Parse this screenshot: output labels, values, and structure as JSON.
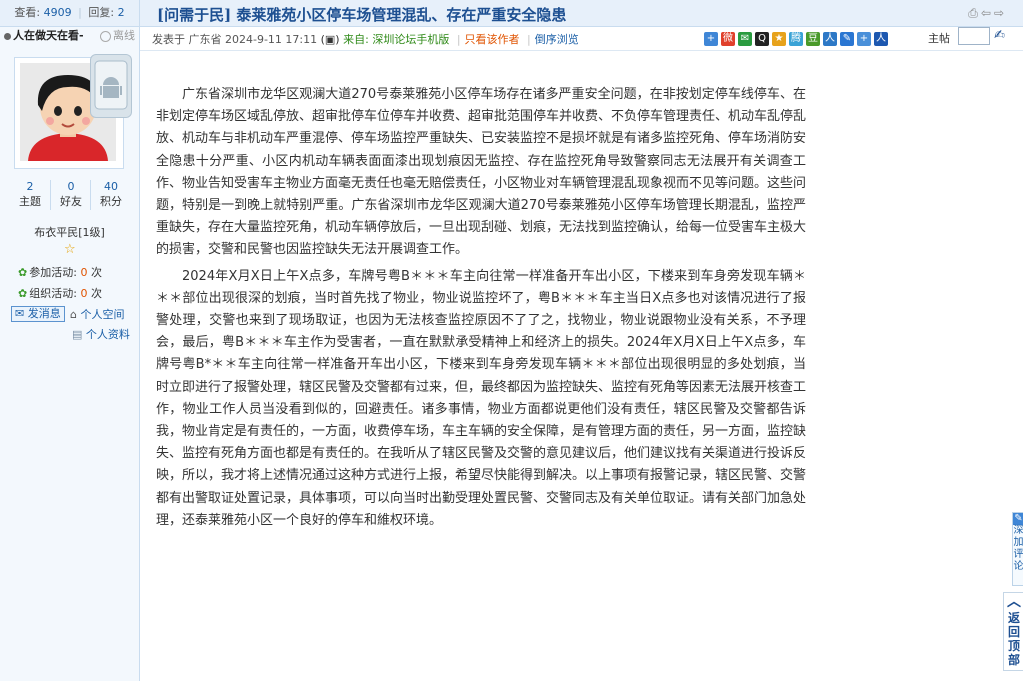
{
  "stats": {
    "views_label": "查看:",
    "views": "4909",
    "replies_label": "回复:",
    "replies": "2"
  },
  "user": {
    "name": "人在做天在看-",
    "status": "离线",
    "counts": [
      {
        "value": "2",
        "label": "主题"
      },
      {
        "value": "0",
        "label": "好友"
      },
      {
        "value": "40",
        "label": "积分"
      }
    ],
    "rank": "布衣平民[1级]",
    "activity1_label": "参加活动:",
    "activity1_value": "0",
    "activity1_unit": "次",
    "activity2_label": "组织活动:",
    "activity2_value": "0",
    "activity2_unit": "次",
    "send_msg": "发消息",
    "space_link": "个人空间",
    "profile_link": "个人资料"
  },
  "thread": {
    "title": "[问需于民] 泰莱雅苑小区停车场管理混乱、存在严重安全隐患",
    "posted_prefix": "发表于 广东省 2024-9-11 17:11",
    "source_label": "来自:",
    "source": "深圳论坛手机版",
    "only_author": "只看该作者",
    "reverse": "倒序浏览",
    "floor_label": "主帖"
  },
  "post": {
    "paragraphs": [
      "广东省深圳市龙华区观澜大道270号泰莱雅苑小区停车场存在诸多严重安全问题，在非按划定停车线停车、在非划定停车场区域乱停放、超审批停车位停车并收费、超审批范围停车并收费、不负停车管理责任、机动车乱停乱放、机动车与非机动车严重混停、停车场监控严重缺失、已安装监控不是损坏就是有诸多监控死角、停车场消防安全隐患十分严重、小区内机动车辆表面面漆出现划痕因无监控、存在监控死角导致警察同志无法展开有关调查工作、物业告知受害车主物业方面毫无责任也毫无赔偿责任，小区物业对车辆管理混乱现象视而不见等问题。这些问题，特别是一到晚上就特别严重。广东省深圳市龙华区观澜大道270号泰莱雅苑小区停车场管理长期混乱，监控严重缺失，存在大量监控死角，机动车辆停放后，一旦出现刮碰、划痕，无法找到监控确认，给每一位受害车主极大的损害，交警和民警也因监控缺失无法开展调查工作。",
      "2024年X月X日上午X点多，车牌号粤B＊＊＊车主向往常一样准备开车出小区，下楼来到车身旁发现车辆＊＊＊部位出现很深的划痕，当时首先找了物业，物业说监控坏了，粤B＊＊＊车主当日X点多也对该情况进行了报警处理，交警也来到了现场取证，也因为无法核查监控原因不了了之，找物业，物业说跟物业没有关系，不予理会，最后，粤B＊＊＊车主作为受害者，一直在默默承受精神上和经济上的损失。2024年X月X日上午X点多，车牌号粤B*＊＊车主向往常一样准备开车出小区，下楼来到车身旁发现车辆＊＊＊部位出现很明显的多处划痕，当时立即进行了报警处理，辖区民警及交警都有过来，但，最终都因为监控缺失、监控有死角等因素无法展开核查工作，物业工作人员当没看到似的，回避责任。诸多事情，物业方面都说更他们没有责任，辖区民警及交警都告诉我，物业肯定是有责任的，一方面，收费停车场，车主车辆的安全保障，是有管理方面的责任，另一方面，监控缺失、监控有死角方面也都是有责任的。在我听从了辖区民警及交警的意见建议后，他们建议找有关渠道进行投诉反映，所以，我才将上述情况通过这种方式进行上报，希望尽快能得到解决。以上事项有报警记录，辖区民警、交警都有出警取证处置记录，具体事项，可以向当时出勤受理处置民警、交警同志及有关单位取证。请有关部门加急处理，还泰莱雅苑小区一个良好的停车和維权环境。"
    ]
  },
  "side": {
    "tab_text": "深加评论",
    "back_top": "返回顶部"
  },
  "colors": {
    "title": "#1d4f91",
    "link": "#1b5fa7",
    "source": "#2f8a18",
    "accent": "#e05300",
    "bar_bg": "#e7f0fa"
  }
}
